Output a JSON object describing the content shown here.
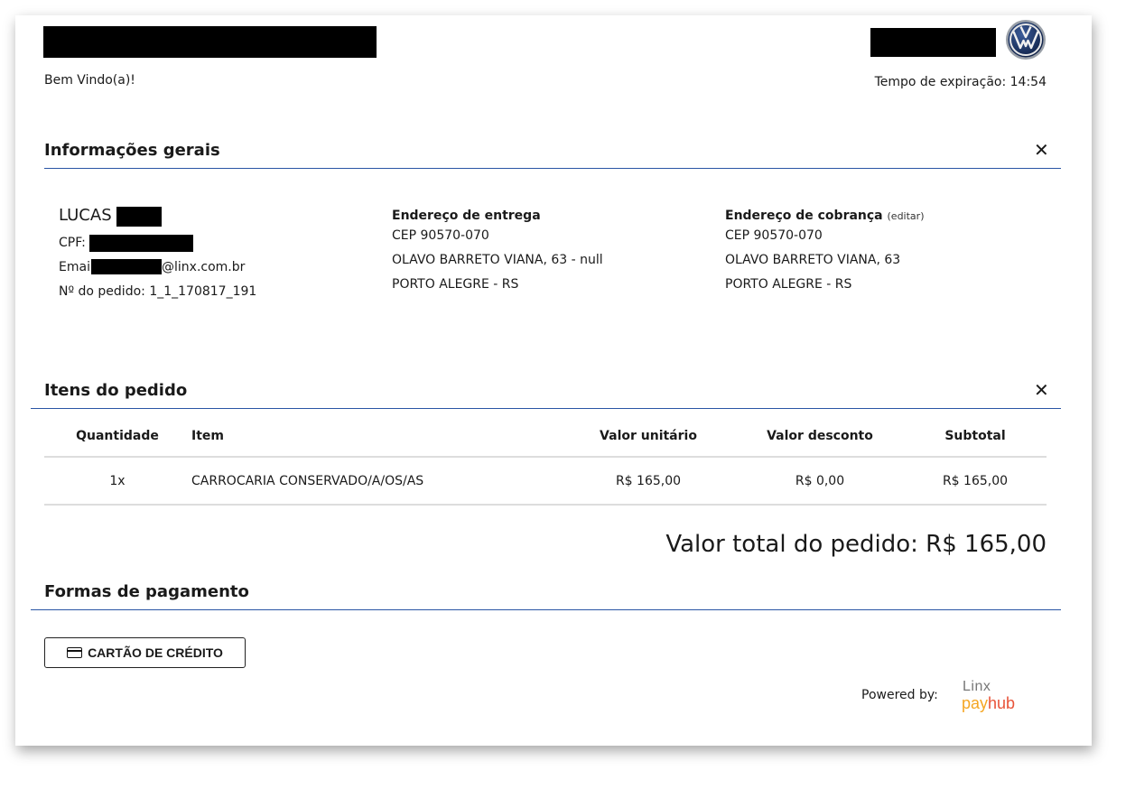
{
  "header": {
    "welcome": "Bem Vindo(a)!",
    "expiry_label": "Tempo de expiração:",
    "expiry_value": "14:54"
  },
  "general_info": {
    "title": "Informações gerais",
    "close_glyph": "✕",
    "customer": {
      "first_name": "LUCAS",
      "cpf_label": "CPF:",
      "email_prefix": "Emai",
      "email_suffix": "@linx.com.br",
      "order_label": "Nº do pedido:",
      "order_number": "1_1_170817_191"
    },
    "delivery": {
      "title": "Endereço de entrega",
      "cep": "CEP 90570-070",
      "street": "OLAVO BARRETO VIANA, 63 - null",
      "city": "PORTO ALEGRE - RS"
    },
    "billing": {
      "title": "Endereço de cobrança",
      "edit": "(editar)",
      "cep": "CEP 90570-070",
      "street": "OLAVO BARRETO VIANA, 63",
      "city": "PORTO ALEGRE - RS"
    }
  },
  "order_items": {
    "title": "Itens do pedido",
    "close_glyph": "✕",
    "columns": [
      "Quantidade",
      "Item",
      "Valor unitário",
      "Valor desconto",
      "Subtotal"
    ],
    "rows": [
      [
        "1x",
        "CARROCARIA CONSERVADO/A/OS/AS",
        "R$ 165,00",
        "R$ 0,00",
        "R$ 165,00"
      ]
    ]
  },
  "total": "Valor total do pedido: R$ 165,00",
  "payment": {
    "title": "Formas de pagamento",
    "credit_card_label": "CARTÃO DE CRÉDITO",
    "credit_card_icon": "credit-card-icon"
  },
  "footer": {
    "powered_by": "Powered by:",
    "logo_top": "Linx",
    "logo_bottom_1": "pay",
    "logo_bottom_2": "hub"
  },
  "colors": {
    "accent_rule": "#2a55a5",
    "logo_orange": "#f5a623",
    "logo_red": "#e8543a"
  }
}
